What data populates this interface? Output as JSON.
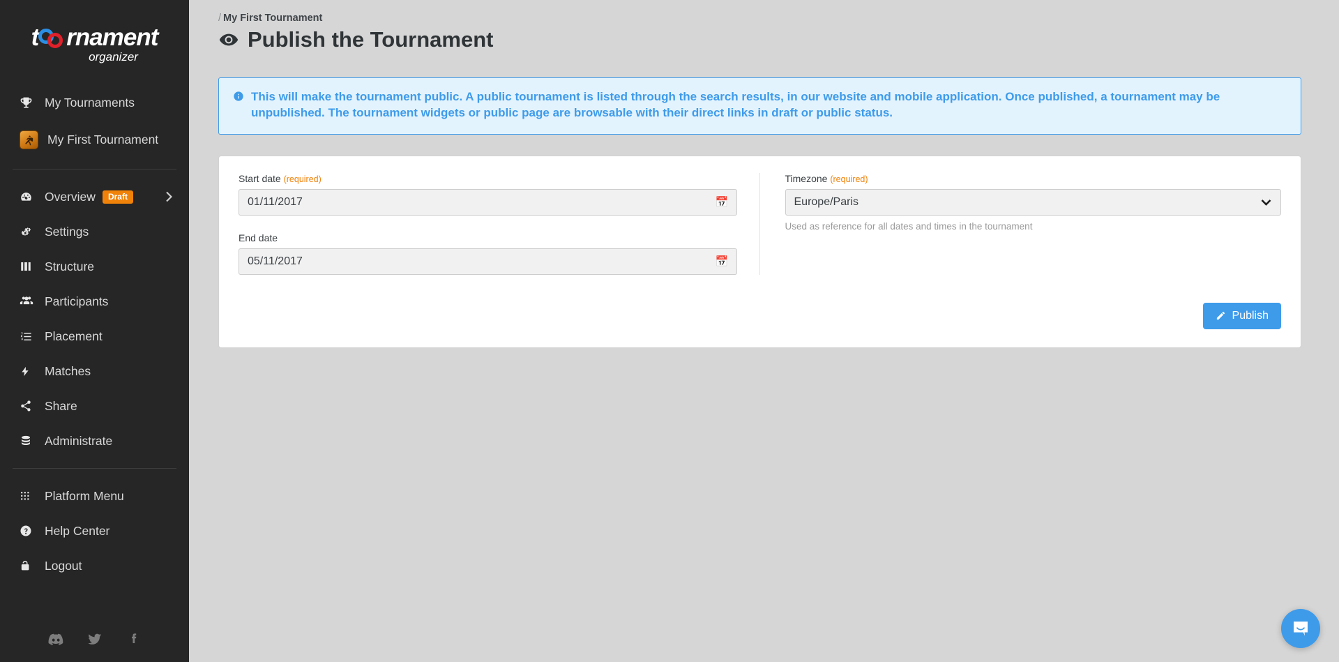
{
  "brand": {
    "logo_primary_prefix": "t",
    "logo_primary_suffix": "rnament",
    "logo_secondary": "organizer",
    "ring_blue": "#2b8ee5",
    "ring_red": "#e0202a"
  },
  "sidebar": {
    "top_items": [
      {
        "label": "My Tournaments",
        "icon": "trophy-icon"
      }
    ],
    "tournament": {
      "label": "My First Tournament",
      "icon": "counter-strike-game-icon"
    },
    "nav_items": [
      {
        "label": "Overview",
        "icon": "dashboard-icon",
        "badge": "Draft",
        "chevron": true
      },
      {
        "label": "Settings",
        "icon": "gears-icon"
      },
      {
        "label": "Structure",
        "icon": "grid-icon"
      },
      {
        "label": "Participants",
        "icon": "users-icon"
      },
      {
        "label": "Placement",
        "icon": "ordered-list-icon"
      },
      {
        "label": "Matches",
        "icon": "bolt-icon"
      },
      {
        "label": "Share",
        "icon": "share-icon"
      },
      {
        "label": "Administrate",
        "icon": "database-icon"
      }
    ],
    "bottom_items": [
      {
        "label": "Platform Menu",
        "icon": "apps-grid-icon"
      },
      {
        "label": "Help Center",
        "icon": "question-circle-icon"
      },
      {
        "label": "Logout",
        "icon": "unlock-icon"
      }
    ],
    "socials": [
      {
        "name": "discord-icon"
      },
      {
        "name": "twitter-icon"
      },
      {
        "name": "facebook-icon"
      }
    ],
    "badge_color": "#f0820a"
  },
  "header": {
    "breadcrumb_slash": "/",
    "breadcrumb_label": "My First Tournament",
    "title": "Publish the Tournament",
    "title_icon": "eye-icon"
  },
  "alert": {
    "icon": "info-circle-icon",
    "text": "This will make the tournament public. A public tournament is listed through the search results, in our website and mobile application. Once published, a tournament may be unpublished. The tournament widgets or public page are browsable with their direct links in draft or public status.",
    "color": "#3e9bea",
    "background": "#e3f3fd"
  },
  "form": {
    "start_date": {
      "label": "Start date",
      "required_text": "(required)",
      "value": "01/11/2017",
      "icon": "calendar-icon"
    },
    "end_date": {
      "label": "End date",
      "value": "05/11/2017",
      "icon": "calendar-icon"
    },
    "timezone": {
      "label": "Timezone",
      "required_text": "(required)",
      "value": "Europe/Paris",
      "help": "Used as reference for all dates and times in the tournament",
      "icon": "chevron-down-icon"
    },
    "publish_button": {
      "label": "Publish",
      "icon": "pencil-icon",
      "color": "#3e9bea"
    }
  },
  "chat_widget": {
    "icon": "chat-bubble-icon",
    "color": "#3e9bea"
  }
}
